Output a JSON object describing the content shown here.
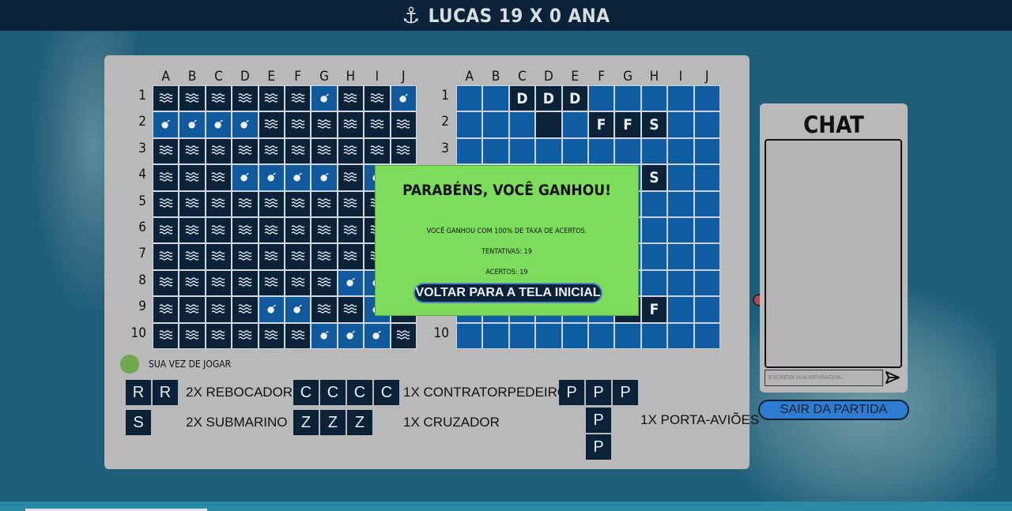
{
  "header": {
    "anchor_icon": "anchor-icon",
    "title": "LUCAS 19 X 0 ANA"
  },
  "boards": {
    "columns": [
      "A",
      "B",
      "C",
      "D",
      "E",
      "F",
      "G",
      "H",
      "I",
      "J"
    ],
    "rows": [
      "1",
      "2",
      "3",
      "4",
      "5",
      "6",
      "7",
      "8",
      "9",
      "10"
    ],
    "left_grid": [
      [
        "w",
        "w",
        "w",
        "w",
        "w",
        "w",
        "h",
        "w",
        "w",
        "h"
      ],
      [
        "h",
        "h",
        "h",
        "h",
        "w",
        "w",
        "w",
        "w",
        "w",
        "w"
      ],
      [
        "w",
        "w",
        "w",
        "w",
        "w",
        "w",
        "w",
        "w",
        "w",
        "w"
      ],
      [
        "w",
        "w",
        "w",
        "h",
        "h",
        "h",
        "h",
        "w",
        "h",
        "h"
      ],
      [
        "w",
        "w",
        "w",
        "w",
        "w",
        "w",
        "w",
        "w",
        "w",
        "w"
      ],
      [
        "w",
        "w",
        "w",
        "w",
        "w",
        "w",
        "w",
        "w",
        "w",
        "w"
      ],
      [
        "w",
        "w",
        "w",
        "w",
        "w",
        "w",
        "w",
        "w",
        "w",
        "w"
      ],
      [
        "w",
        "w",
        "w",
        "w",
        "w",
        "w",
        "w",
        "h",
        "h",
        "w"
      ],
      [
        "w",
        "w",
        "w",
        "w",
        "h",
        "h",
        "w",
        "w",
        "h",
        "w"
      ],
      [
        "w",
        "w",
        "w",
        "w",
        "w",
        "w",
        "h",
        "h",
        "h",
        "w"
      ]
    ],
    "right_grid": [
      [
        "",
        "",
        "D",
        "D",
        "D",
        "",
        "",
        "",
        "",
        ""
      ],
      [
        "",
        "",
        "",
        "#",
        "",
        "F",
        "F",
        "S",
        "",
        ""
      ],
      [
        "",
        "",
        "",
        "",
        "",
        "",
        "",
        "",
        "",
        ""
      ],
      [
        "",
        "",
        "",
        "",
        "",
        "",
        "",
        "S",
        "",
        ""
      ],
      [
        "",
        "",
        "",
        "",
        "",
        "",
        "",
        "",
        "",
        ""
      ],
      [
        "",
        "",
        "",
        "",
        "",
        "",
        "",
        "",
        "",
        ""
      ],
      [
        "",
        "",
        "",
        "",
        "",
        "",
        "",
        "",
        "",
        ""
      ],
      [
        "",
        "",
        "",
        "",
        "",
        "",
        "",
        "",
        "",
        ""
      ],
      [
        "",
        "",
        "",
        "",
        "",
        "",
        "#",
        "F",
        "",
        ""
      ],
      [
        "",
        "",
        "",
        "",
        "",
        "",
        "",
        "",
        "",
        ""
      ]
    ]
  },
  "modal": {
    "title": "PARABÉNS, VOCÊ GANHOU!",
    "line1": "VOCÊ GANHOU COM 100% DE TAXA DE ACERTOS.",
    "line2": "TENTATIVAS: 19",
    "line3": "ACERTOS: 19",
    "button": "VOLTAR PARA A TELA INICIAL"
  },
  "turn": {
    "label": "SUA VEZ DE JOGAR",
    "color": "#6fa84d"
  },
  "legend": {
    "rebocador": {
      "tiles": [
        "R",
        "R"
      ],
      "label": "2X REBOCADOR"
    },
    "submarino": {
      "tiles": [
        "S"
      ],
      "label": "2X SUBMARINO"
    },
    "contratorpedeiro": {
      "tiles": [
        "C",
        "C",
        "C",
        "C"
      ],
      "label": "1X CONTRATORPEDEIRO"
    },
    "cruzador": {
      "tiles": [
        "Z",
        "Z",
        "Z"
      ],
      "label": "1X CRUZADOR"
    },
    "porta_avioes": {
      "tiles": [
        "P",
        "P",
        "P",
        "P",
        "P"
      ],
      "label": "1X PORTA-AVIÕES"
    }
  },
  "chat": {
    "title": "CHAT",
    "input_placeholder": "ESCREVA SUA MENSAGEM...",
    "send_icon": "send-icon"
  },
  "leave_button": "SAIR DA PARTIDA",
  "colors": {
    "dark": "#0b2238",
    "blue": "#0f5ca3",
    "win": "#7ddc5b"
  }
}
